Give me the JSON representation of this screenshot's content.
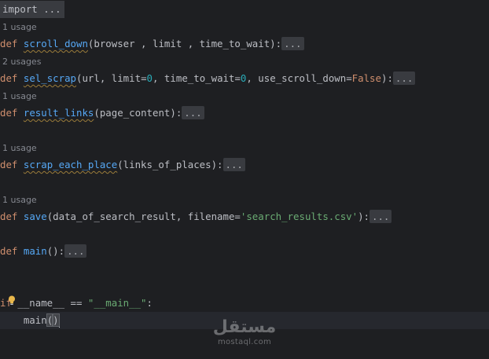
{
  "lines": {
    "import": "import ...",
    "usage1": "1 usage",
    "scroll_down_fn": "scroll_down",
    "scroll_down_params": "(browser , limit , time_to_wait):",
    "usage2": "2 usages",
    "sel_scrap_fn": "sel_scrap",
    "sel_scrap_p1": "(url, ",
    "sel_scrap_limit": "limit",
    "sel_scrap_p2": "=",
    "sel_scrap_zero1": "0",
    "sel_scrap_p3": ", time_to_wait=",
    "sel_scrap_zero2": "0",
    "sel_scrap_p4": ", use_scroll_down=",
    "sel_scrap_false": "False",
    "sel_scrap_p5": "):",
    "usage3": "1 usage",
    "result_links_fn": "result_links",
    "result_links_params": "(page_content):",
    "usage4": "1 usage",
    "scrap_each_fn": "scrap_each_place",
    "scrap_each_params": "(links_of_places):",
    "usage5": "1 usage",
    "save_fn": "save",
    "save_p1": "(data_of_search_result, filename=",
    "save_str": "'search_results.csv'",
    "save_p2": "):",
    "main_fn": "main",
    "main_params": "():",
    "if_kw": "if",
    "if_rest": " __name__ == ",
    "if_str": "\"__main__\"",
    "if_colon": ":",
    "call_main": "main",
    "call_open": "(",
    "call_close": ")",
    "def_kw": "def",
    "fold": "..."
  },
  "watermark": {
    "arabic": "مستقل",
    "latin": "mostaql.com"
  },
  "icons": {
    "intention": "lightbulb-icon"
  },
  "colors": {
    "background": "#1e1f22",
    "keyword": "#cf8e6d",
    "function": "#56a8f5",
    "number": "#2aacb8",
    "string": "#6aab73",
    "hint": "#868991"
  }
}
